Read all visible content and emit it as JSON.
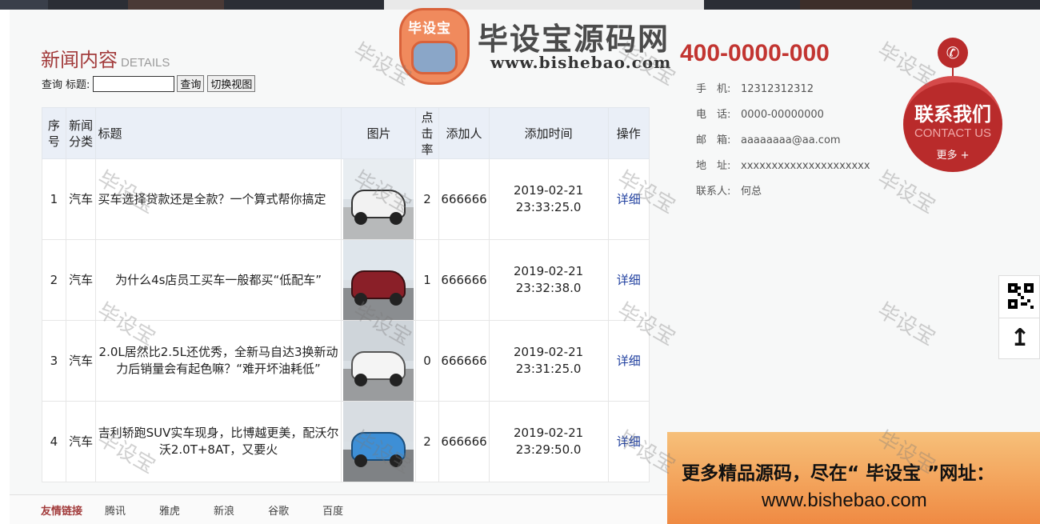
{
  "logo": {
    "badge_text": "毕设宝",
    "title": "毕设宝源码网",
    "url": "www.bishebao.com"
  },
  "section": {
    "title": "新闻内容",
    "subtitle": "DETAILS"
  },
  "search": {
    "prefix": "查询",
    "field_label": "标题:",
    "value": "",
    "query_button": "查询",
    "switch_button": "切换视图"
  },
  "table": {
    "headers": {
      "index": "序号",
      "category": "新闻分类",
      "title": "标题",
      "image": "图片",
      "clicks": "点击率",
      "author": "添加人",
      "time": "添加时间",
      "action": "操作"
    },
    "rows": [
      {
        "index": "1",
        "category": "汽车",
        "title": "买车选择贷款还是全款？一个算式帮你搞定",
        "clicks": "2",
        "author": "666666",
        "date": "2019-02-21",
        "time": "23:33:25.0",
        "action": "详细"
      },
      {
        "index": "2",
        "category": "汽车",
        "title": "为什么4s店员工买车一般都买“低配车”",
        "clicks": "1",
        "author": "666666",
        "date": "2019-02-21",
        "time": "23:32:38.0",
        "action": "详细"
      },
      {
        "index": "3",
        "category": "汽车",
        "title": "2.0L居然比2.5L还优秀，全新马自达3换新动力后销量会有起色嘛？“难开坏油耗低”",
        "clicks": "0",
        "author": "666666",
        "date": "2019-02-21",
        "time": "23:31:25.0",
        "action": "详细"
      },
      {
        "index": "4",
        "category": "汽车",
        "title": "吉利轿跑SUV实车现身，比博越更美，配沃尔沃2.0T+8AT，又要火",
        "clicks": "2",
        "author": "666666",
        "date": "2019-02-21",
        "time": "23:29:50.0",
        "action": "详细"
      }
    ]
  },
  "contact": {
    "hotline": "400-0000-000",
    "mobile_label": "手　机:",
    "mobile": "12312312312",
    "tel_label": "电　话:",
    "tel": "0000-00000000",
    "email_label": "邮　箱:",
    "email": "aaaaaaaa@aa.com",
    "addr_label": "地　址:",
    "addr": "xxxxxxxxxxxxxxxxxxxxx",
    "person_label": "联系人:",
    "person": "何总",
    "badge_title": "联系我们",
    "badge_en": "CONTACT US",
    "badge_more": "更多 +"
  },
  "footer": {
    "label": "友情链接",
    "links": [
      "腾讯",
      "雅虎",
      "新浪",
      "谷歌",
      "百度"
    ]
  },
  "promo": {
    "line1": "更多精品源码，尽在“ 毕设宝 ”网址：",
    "line2": "www.bishebao.com"
  },
  "watermark": "毕设宝",
  "colors": {
    "accent": "#a23b3b",
    "hotline": "#c23531",
    "badge": "#b92b2b",
    "link": "#1d3d9e"
  }
}
